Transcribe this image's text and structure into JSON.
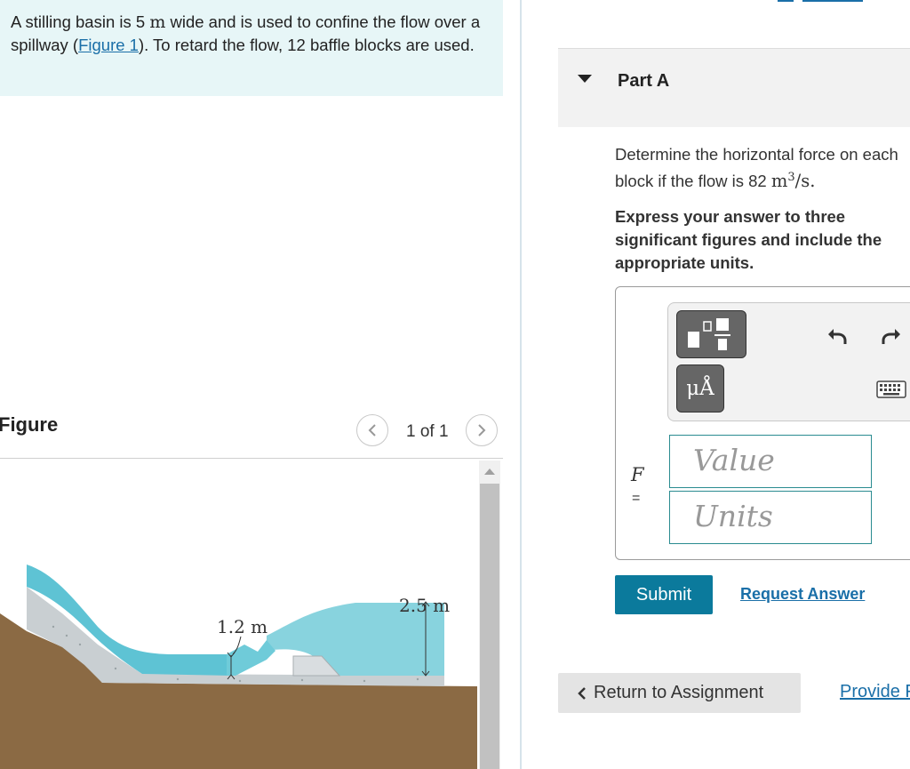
{
  "problem": {
    "text_1": "A stilling basin is 5 ",
    "width_unit": "m",
    "text_2": " wide and is used to confine the flow over a spillway (",
    "figure_link": "Figure 1",
    "text_3": "). To retard the flow, 12 baffle blocks are used."
  },
  "figure_panel": {
    "title": "Figure",
    "counter": "1 of 1",
    "dims": {
      "upstream_depth": "1.2 m",
      "downstream_depth": "2.5 m"
    }
  },
  "part": {
    "label": "Part A",
    "question_1": "Determine the horizontal force on each block if the flow is 82 ",
    "question_unit": "m",
    "question_exp": "3",
    "question_2": "/s.",
    "instruction": "Express your answer to three significant figures and include the appropriate units."
  },
  "toolbar": {
    "units_label": "μÅ"
  },
  "answer": {
    "variable": "F",
    "equals": "=",
    "value_placeholder": "Value",
    "units_placeholder": "Units"
  },
  "actions": {
    "submit": "Submit",
    "request_answer": "Request Answer",
    "return": "Return to Assignment",
    "provide": "Provide Feedback"
  },
  "colors": {
    "link": "#1a6fa8",
    "primary_button": "#0b7a9c",
    "problem_bg": "#e7f6f7",
    "water": "#5ec3d4",
    "earth": "#8b6a44",
    "concrete": "#c9cfd2"
  },
  "icons": [
    "chevron-left-icon",
    "chevron-right-icon",
    "template-icon",
    "undo-icon",
    "redo-icon",
    "keyboard-icon",
    "chevron-left-icon"
  ]
}
